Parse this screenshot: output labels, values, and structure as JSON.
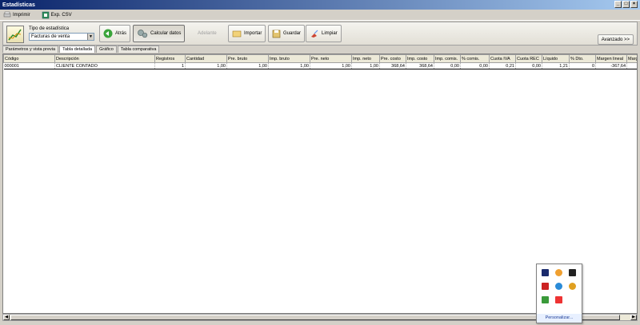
{
  "window": {
    "title": "Estadísticas"
  },
  "menu": {
    "print_label": "Imprimir",
    "export_label": "Exp. CSV"
  },
  "toolbar": {
    "tipo_label": "Tipo de estadística",
    "tipo_value": "Facturas de venta",
    "back_label": "Atrás",
    "calc_label": "Calcular datos",
    "next_label": "Adelante",
    "import_label": "Importar",
    "save_label": "Guardar",
    "clear_label": "Limpiar",
    "advanced_label": "Avanzado >>"
  },
  "tabs": [
    "Parámetros y vista previa",
    "Tabla detallada",
    "Gráfico",
    "Tabla comparativa"
  ],
  "table": {
    "columns": [
      "Código",
      "Descripción",
      "Registros",
      "Cantidad",
      "Pre. bruto",
      "Imp. bruto",
      "Pre. neto",
      "Imp. neto",
      "Pre. costo",
      "Imp. costo",
      "Imp. comis.",
      "% comis.",
      "Cuota IVA",
      "Cuota REC",
      "Líquido",
      "% Dto.",
      "Margen lineal",
      "Marg"
    ],
    "rows": [
      [
        "000001",
        "CLIENTE CONTADO",
        "1",
        "1,00",
        "1,00",
        "1,00",
        "1,00",
        "1,00",
        "368,64",
        "368,64",
        "0,00",
        "0,00",
        "0,21",
        "0,00",
        "1,21",
        "0",
        "-367,64",
        ""
      ]
    ]
  },
  "popup": {
    "customize_label": "Personalizar..."
  }
}
